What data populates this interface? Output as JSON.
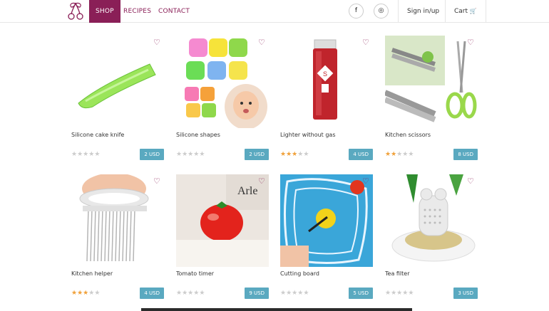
{
  "nav": {
    "links": [
      "SHOP",
      "RECIPES",
      "CONTACT"
    ],
    "signin": "Sign in/up",
    "cart": "Cart"
  },
  "icons": {
    "facebook": "f",
    "instagram": "◎",
    "cart": "🛒",
    "heart": "♡",
    "star": "★"
  },
  "colors": {
    "brand": "#8a1f57",
    "price": "#5aa9c0",
    "star_on": "#f0a13a",
    "star_off": "#cccccc"
  },
  "products": [
    {
      "title": "Silicone cake knife",
      "price": "2 USD",
      "rating": 0
    },
    {
      "title": "Silicone shapes",
      "price": "2 USD",
      "rating": 0
    },
    {
      "title": "Lighter without gas",
      "price": "4 USD",
      "rating": 3
    },
    {
      "title": "Kitchen scissors",
      "price": "8 USD",
      "rating": 2
    },
    {
      "title": "Kitchen helper",
      "price": "4 USD",
      "rating": 3
    },
    {
      "title": "Tomato timer",
      "price": "9 USD",
      "rating": 0
    },
    {
      "title": "Cutting board",
      "price": "5 USD",
      "rating": 0
    },
    {
      "title": "Tea filter",
      "price": "3 USD",
      "rating": 0
    }
  ]
}
